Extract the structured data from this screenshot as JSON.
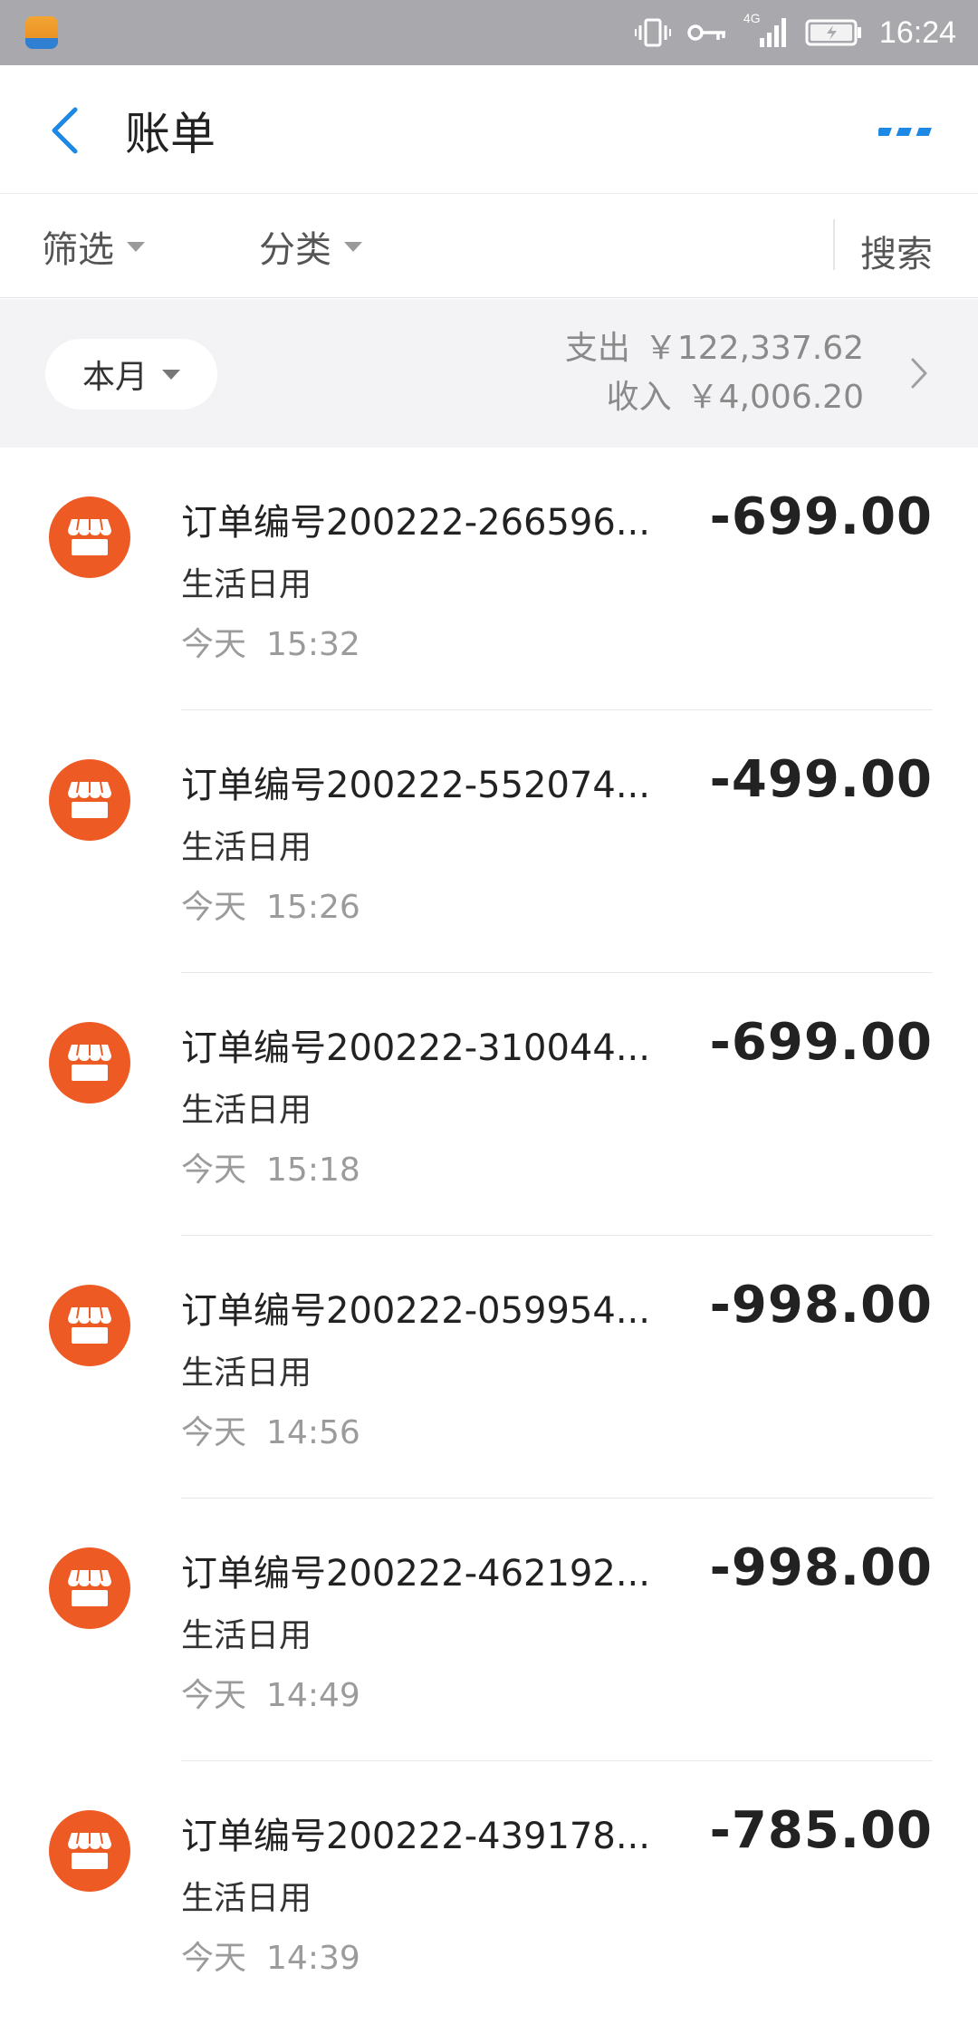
{
  "status_bar": {
    "time": "16:24",
    "network": "4G",
    "icons": [
      "app-icon",
      "vibrate-icon",
      "key-icon",
      "signal-icon",
      "battery-icon"
    ]
  },
  "header": {
    "title": "账单"
  },
  "filters": {
    "filter_label": "筛选",
    "category_label": "分类",
    "search_label": "搜索"
  },
  "summary": {
    "period": "本月",
    "expense_label": "支出",
    "expense_value": "￥122,337.62",
    "income_label": "收入",
    "income_value": "￥4,006.20"
  },
  "transactions": [
    {
      "title": "订单编号200222-266596...",
      "category": "生活日用",
      "day": "今天",
      "time": "15:32",
      "amount": "-699.00"
    },
    {
      "title": "订单编号200222-552074...",
      "category": "生活日用",
      "day": "今天",
      "time": "15:26",
      "amount": "-499.00"
    },
    {
      "title": "订单编号200222-310044...",
      "category": "生活日用",
      "day": "今天",
      "time": "15:18",
      "amount": "-699.00"
    },
    {
      "title": "订单编号200222-059954...",
      "category": "生活日用",
      "day": "今天",
      "time": "14:56",
      "amount": "-998.00"
    },
    {
      "title": "订单编号200222-462192...",
      "category": "生活日用",
      "day": "今天",
      "time": "14:49",
      "amount": "-998.00"
    },
    {
      "title": "订单编号200222-439178...",
      "category": "生活日用",
      "day": "今天",
      "time": "14:39",
      "amount": "-785.00"
    }
  ],
  "colors": {
    "accent": "#1e88e5",
    "status_bar": "#a8a8ad",
    "shop_icon_bg": "#ee5a24"
  }
}
